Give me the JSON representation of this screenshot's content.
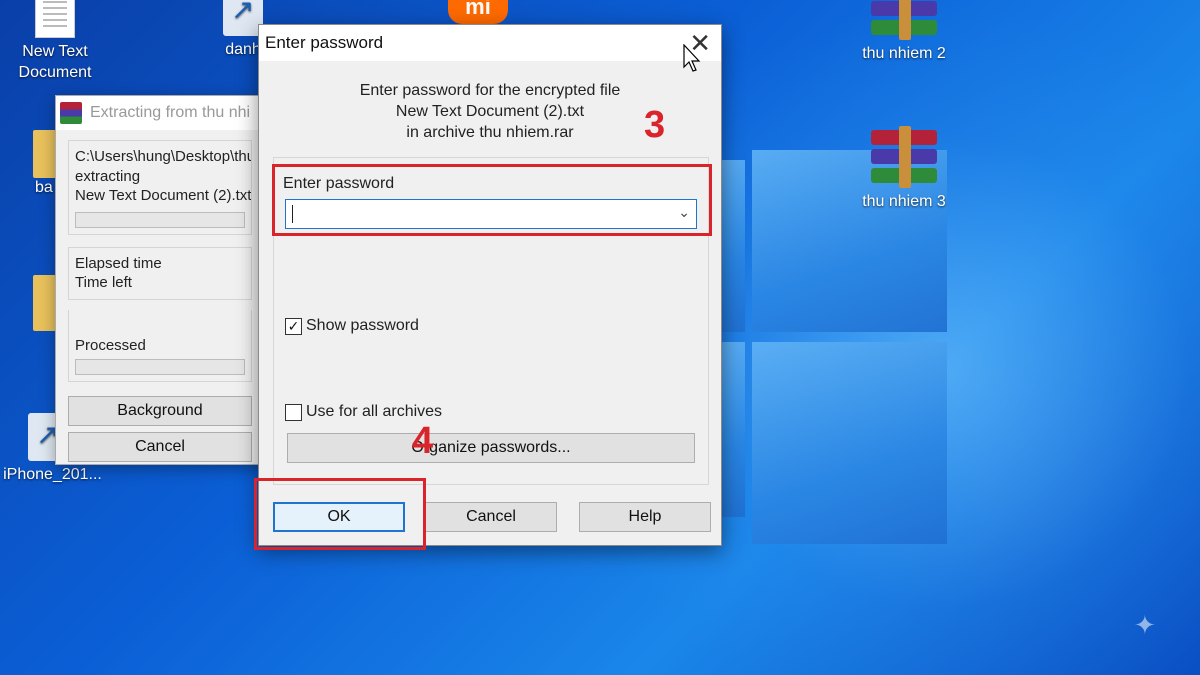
{
  "desktop": {
    "icons": [
      {
        "label": "New Text\nDocument"
      },
      {
        "label": "danh"
      },
      {
        "label": "thu nhiem 2"
      },
      {
        "label": "thu nhiem 3"
      },
      {
        "label": "ba"
      },
      {
        "label": "iPhone_201..."
      }
    ],
    "mi_logo_text": "mi"
  },
  "extract_window": {
    "title": "Extracting from thu nhi",
    "path": "C:\\Users\\hung\\Desktop\\thu",
    "status": "extracting",
    "file": "New Text Document (2).txt",
    "elapsed_label": "Elapsed time",
    "timeleft_label": "Time left",
    "processed_label": "Processed",
    "background_button": "Background",
    "cancel_button": "Cancel"
  },
  "password_dialog": {
    "title": "Enter password",
    "info_line1": "Enter password for the encrypted file",
    "info_line2": "New Text Document (2).txt",
    "info_line3": "in archive thu nhiem.rar",
    "password_label": "Enter password",
    "password_value": "",
    "show_password_label": "Show password",
    "show_password_checked": true,
    "use_all_label": "Use for all archives",
    "use_all_checked": false,
    "organize_button": "Organize passwords...",
    "ok_button": "OK",
    "cancel_button": "Cancel",
    "help_button": "Help"
  },
  "annotations": {
    "step3": "3",
    "step4": "4",
    "color": "#d9242b"
  }
}
